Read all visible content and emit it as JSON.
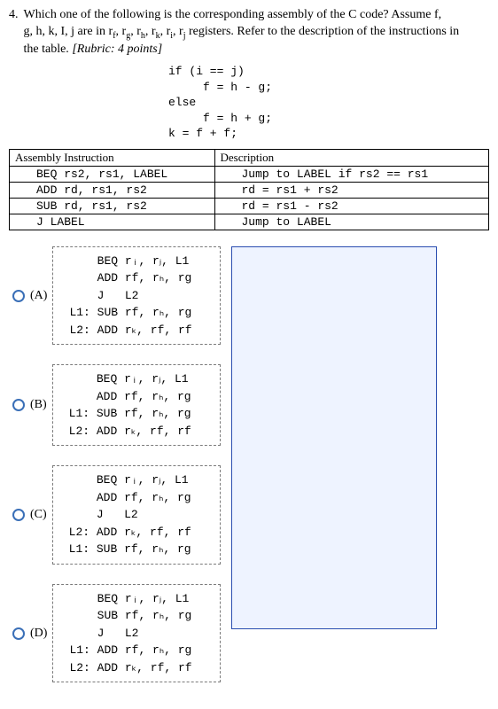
{
  "question": {
    "number": "4.",
    "text_line1": "Which one of the following is the corresponding assembly of the C code? Assume f,",
    "text_line2": "g, h, k, I, j are in r",
    "regs_inline": "f",
    "text_line2b": ", r",
    "regs_inline2": "g",
    "text_line2c": ", r",
    "regs_inline3": "h",
    "text_line2d": ", r",
    "regs_inline4": "k",
    "text_line2e": ", r",
    "regs_inline5": "i",
    "text_line2f": ", r",
    "regs_inline6": "j",
    "text_line2g": " registers. Refer to the description of the instructions in",
    "text_line3": "the table. ",
    "rubric": "[Rubric: 4 points]"
  },
  "c_code": "if (i == j)\n     f = h - g;\nelse\n     f = h + g;\nk = f + f;",
  "table": {
    "h1": "Assembly Instruction",
    "h2": "Description",
    "rows": [
      {
        "instr": "BEQ   rs2, rs1, LABEL",
        "desc": "Jump to LABEL if rs2 == rs1"
      },
      {
        "instr": "ADD   rd, rs1, rs2",
        "desc": "rd = rs1 + rs2"
      },
      {
        "instr": "SUB   rd, rs1, rs2",
        "desc": "rd = rs1 - rs2"
      },
      {
        "instr": "J     LABEL",
        "desc": "Jump to LABEL"
      }
    ]
  },
  "choices": [
    {
      "label": "(A)",
      "code": "    BEQ rᵢ, rⱼ, L1\n    ADD rf, rₕ, rg\n    J   L2\nL1: SUB rf, rₕ, rg\nL2: ADD rₖ, rf, rf"
    },
    {
      "label": "(B)",
      "code": "    BEQ rᵢ, rⱼ, L1\n    ADD rf, rₕ, rg\nL1: SUB rf, rₕ, rg\nL2: ADD rₖ, rf, rf"
    },
    {
      "label": "(C)",
      "code": "    BEQ rᵢ, rⱼ, L1\n    ADD rf, rₕ, rg\n    J   L2\nL2: ADD rₖ, rf, rf\nL1: SUB rf, rₕ, rg"
    },
    {
      "label": "(D)",
      "code": "    BEQ rᵢ, rⱼ, L1\n    SUB rf, rₕ, rg\n    J   L2\nL1: ADD rf, rₕ, rg\nL2: ADD rₖ, rf, rf"
    }
  ]
}
